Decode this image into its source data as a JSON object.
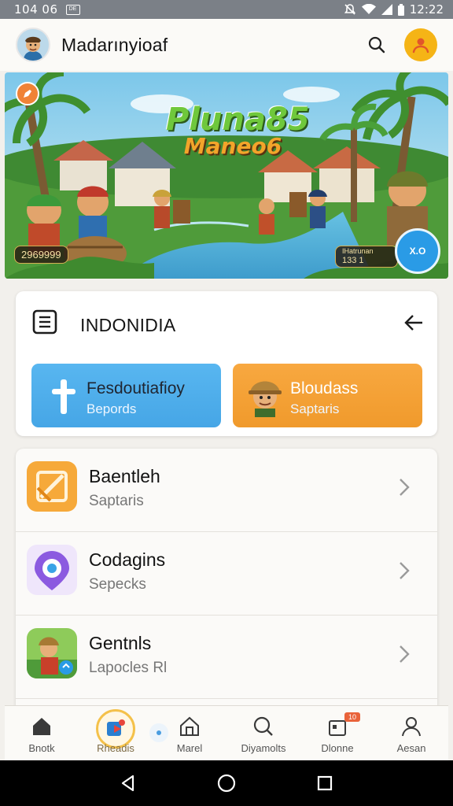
{
  "status_bar": {
    "time_left": "104 06",
    "box_label": "DE",
    "time_right": "12:22",
    "icons": [
      "notification-muted-icon",
      "wifi-icon",
      "signal-icon",
      "battery-icon"
    ]
  },
  "header": {
    "title": "Madarınyioaf",
    "avatar_icon": "user-avatar",
    "search_icon": "search-icon",
    "profile_icon": "profile-icon",
    "profile_color": "#f5b416"
  },
  "banner": {
    "game_title_line1": "Pluna85",
    "game_title_line2": "Maneo6",
    "badge_left": "2969999",
    "badge_right_line1": "IHatrunan",
    "badge_right_line2": "133 1",
    "fab_label": "X.O"
  },
  "region_card": {
    "title": "INDONIDIA",
    "tiles": [
      {
        "title": "Fesdoutiafioy",
        "subtitle": "Bepords",
        "color": "#4aa9e8"
      },
      {
        "title": "Bloudass",
        "subtitle": "Saptaris",
        "color": "#f4a336"
      }
    ]
  },
  "list": {
    "items": [
      {
        "title": "Baentleh",
        "subtitle": "Saptaris",
        "icon": "edit-box-icon"
      },
      {
        "title": "Codagins",
        "subtitle": "Sepecks",
        "icon": "target-icon"
      },
      {
        "title": "Gentnls",
        "subtitle": "Lapocles Rl",
        "icon": "character-game-icon"
      }
    ]
  },
  "bottom_nav": {
    "items": [
      {
        "label": "Bnotk",
        "icon": "home-icon"
      },
      {
        "label": "Rheadis",
        "icon": "play-icon"
      },
      {
        "label": "Marel",
        "icon": "house-outline-icon"
      },
      {
        "label": "Diyamolts",
        "icon": "search-icon"
      },
      {
        "label": "Dlonne",
        "icon": "gift-icon",
        "badge": "10"
      },
      {
        "label": "Aesan",
        "icon": "person-icon"
      }
    ]
  }
}
